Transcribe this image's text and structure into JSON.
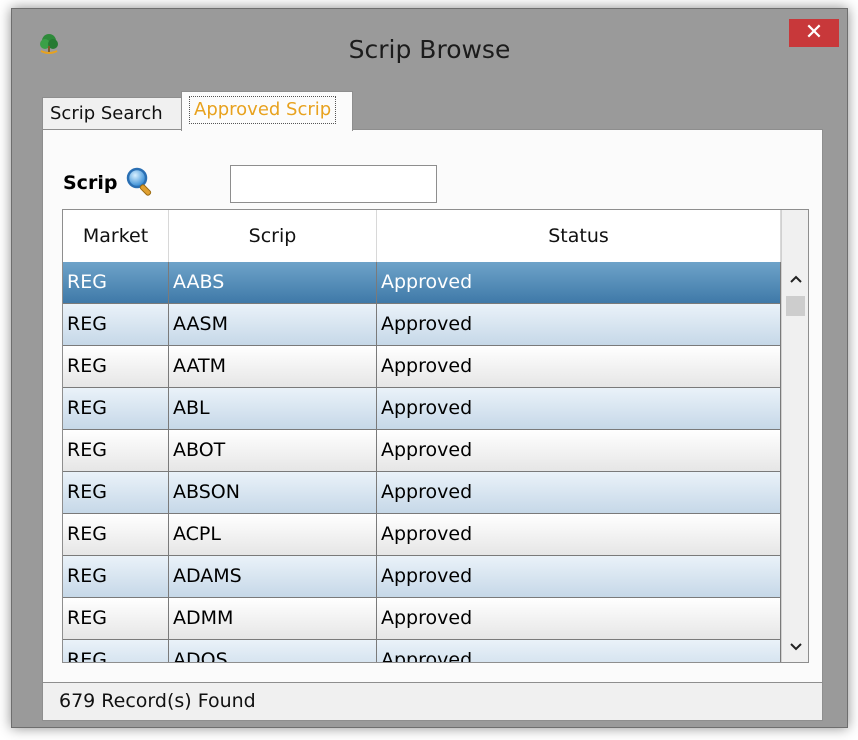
{
  "window": {
    "title": "Scrip Browse",
    "close_label": "✕"
  },
  "tabs": [
    {
      "label": "Scrip Search",
      "active": false
    },
    {
      "label": "Approved Scrip",
      "active": true
    }
  ],
  "search": {
    "label": "Scrip",
    "value": "",
    "icon": "search-icon"
  },
  "table": {
    "columns": [
      "Market",
      "Scrip",
      "Status"
    ],
    "rows": [
      {
        "market": "REG",
        "scrip": "AABS",
        "status": "Approved",
        "selected": true
      },
      {
        "market": "REG",
        "scrip": "AASM",
        "status": "Approved"
      },
      {
        "market": "REG",
        "scrip": "AATM",
        "status": "Approved"
      },
      {
        "market": "REG",
        "scrip": "ABL",
        "status": "Approved"
      },
      {
        "market": "REG",
        "scrip": "ABOT",
        "status": "Approved"
      },
      {
        "market": "REG",
        "scrip": "ABSON",
        "status": "Approved"
      },
      {
        "market": "REG",
        "scrip": "ACPL",
        "status": "Approved"
      },
      {
        "market": "REG",
        "scrip": "ADAMS",
        "status": "Approved"
      },
      {
        "market": "REG",
        "scrip": "ADMM",
        "status": "Approved"
      },
      {
        "market": "REG",
        "scrip": "ADOS",
        "status": "Approved"
      }
    ]
  },
  "scrollbar": {
    "up_glyph": "^",
    "down_glyph": "v"
  },
  "status_bar": {
    "text": "679 Record(s) Found"
  },
  "colors": {
    "close_button": "#c8383a",
    "active_tab_text": "#e8a21e",
    "selected_row": "#4f88b6",
    "alt_row": "#d6e4ef"
  }
}
